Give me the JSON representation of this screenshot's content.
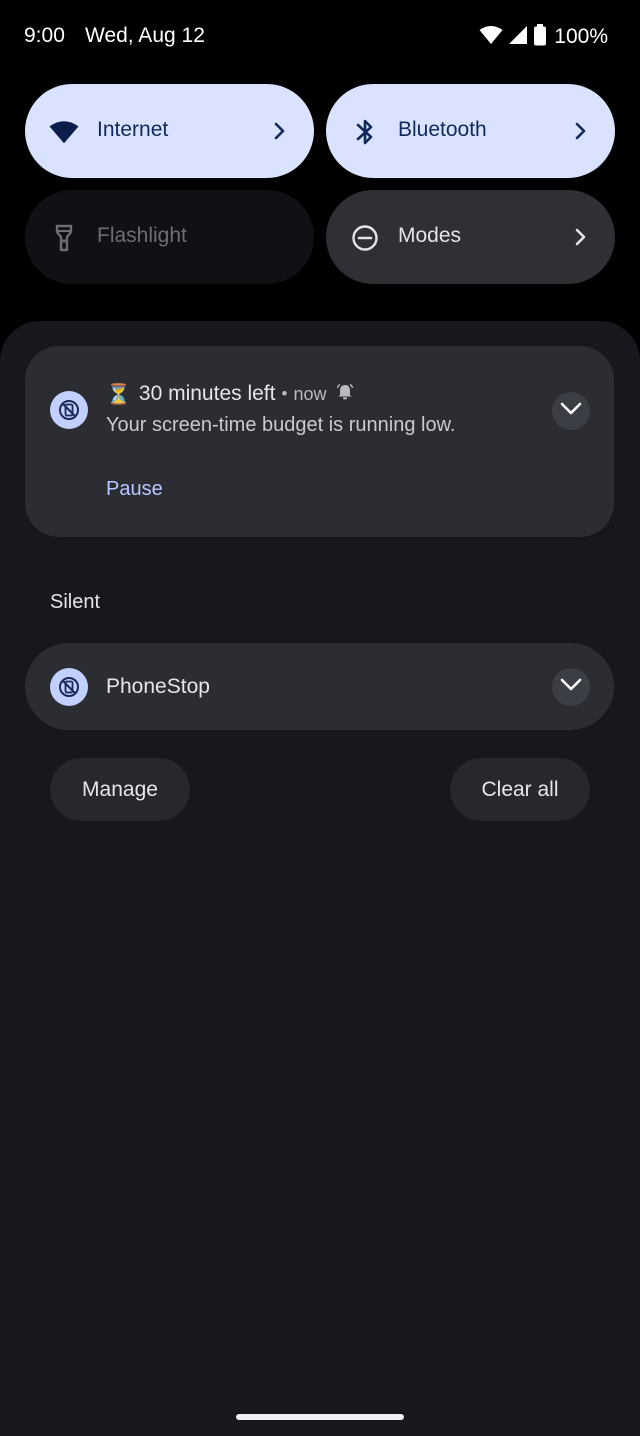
{
  "status_bar": {
    "time": "9:00",
    "date": "Wed, Aug 12",
    "battery_percent": "100%",
    "icons": [
      "wifi-icon",
      "cell-signal-icon",
      "battery-icon"
    ]
  },
  "quick_tiles": [
    {
      "label": "Internet",
      "icon": "wifi-icon",
      "state": "on",
      "has_chevron": true
    },
    {
      "label": "Bluetooth",
      "icon": "bluetooth-icon",
      "state": "on",
      "has_chevron": true
    },
    {
      "label": "Flashlight",
      "icon": "flashlight-icon",
      "state": "off",
      "has_chevron": false
    },
    {
      "label": "Modes",
      "icon": "do-not-disturb-icon",
      "state": "neutral",
      "has_chevron": true
    }
  ],
  "notification": {
    "emoji": "⏳",
    "title": "30 minutes left",
    "separator": "•",
    "time": "now",
    "text": "Your screen-time budget is running low.",
    "action": "Pause",
    "app_icon": "phone-stop-icon",
    "alert_icon": "alert-bell-icon"
  },
  "silent_section": {
    "label": "Silent",
    "app_name": "PhoneStop",
    "app_icon": "phone-stop-icon"
  },
  "footer": {
    "manage_label": "Manage",
    "clear_all_label": "Clear all"
  },
  "colors": {
    "tile_on": "#d9e2ff",
    "tile_on_text": "#102a5c",
    "sheet_bg": "#16181d",
    "card_bg": "#2b2d33",
    "accent_action": "#b8c7ff"
  }
}
